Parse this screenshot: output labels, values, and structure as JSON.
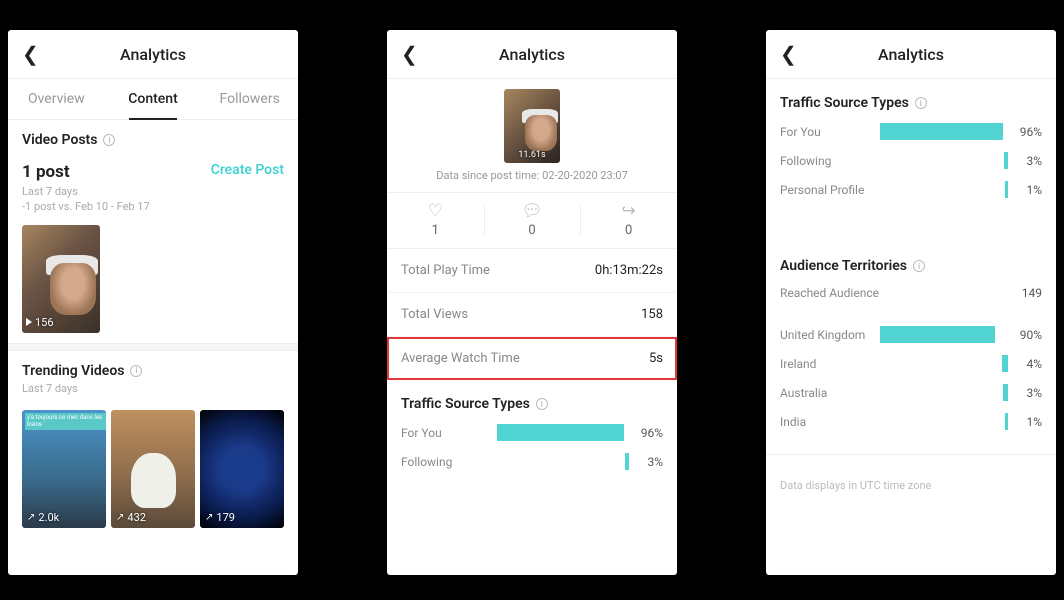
{
  "header": {
    "title": "Analytics"
  },
  "tabs": {
    "overview": "Overview",
    "content": "Content",
    "followers": "Followers"
  },
  "screen1": {
    "video_posts_title": "Video Posts",
    "post_count": "1 post",
    "create_post": "Create Post",
    "last7": "Last 7 days",
    "compare": "-1 post vs. Feb 10 - Feb 17",
    "thumb_plays": "156",
    "trending_title": "Trending Videos",
    "trending_sub": "Last 7 days",
    "trending": [
      {
        "label": "2.0k",
        "badge": "y'a toujours ce mec dans les trains"
      },
      {
        "label": "432"
      },
      {
        "label": "179"
      }
    ]
  },
  "screen2": {
    "duration": "11.61s",
    "since": "Data since post time: 02-20-2020 23:07",
    "likes": "1",
    "comments": "0",
    "shares": "0",
    "rows": [
      {
        "label": "Total Play Time",
        "val": "0h:13m:22s"
      },
      {
        "label": "Total Views",
        "val": "158"
      },
      {
        "label": "Average Watch Time",
        "val": "5s"
      }
    ],
    "traffic_title": "Traffic Source Types",
    "traffic": [
      {
        "label": "For You",
        "pct": 96,
        "disp": "96%"
      },
      {
        "label": "Following",
        "pct": 3,
        "disp": "3%"
      }
    ]
  },
  "screen3": {
    "traffic_title": "Traffic Source Types",
    "traffic": [
      {
        "label": "For You",
        "pct": 96,
        "disp": "96%"
      },
      {
        "label": "Following",
        "pct": 3,
        "disp": "3%"
      },
      {
        "label": "Personal Profile",
        "pct": 1,
        "disp": "1%"
      }
    ],
    "territories_title": "Audience Territories",
    "reached_label": "Reached Audience",
    "reached_val": "149",
    "countries": [
      {
        "label": "United Kingdom",
        "pct": 90,
        "disp": "90%"
      },
      {
        "label": "Ireland",
        "pct": 4,
        "disp": "4%"
      },
      {
        "label": "Australia",
        "pct": 3,
        "disp": "3%"
      },
      {
        "label": "India",
        "pct": 1,
        "disp": "1%"
      }
    ],
    "footnote": "Data displays in UTC time zone"
  },
  "chart_data": [
    {
      "type": "bar",
      "title": "Traffic Source Types",
      "categories": [
        "For You",
        "Following",
        "Personal Profile"
      ],
      "values": [
        96,
        3,
        1
      ],
      "xlabel": "",
      "ylabel": "percent",
      "ylim": [
        0,
        100
      ]
    },
    {
      "type": "bar",
      "title": "Audience Territories",
      "categories": [
        "United Kingdom",
        "Ireland",
        "Australia",
        "India"
      ],
      "values": [
        90,
        4,
        3,
        1
      ],
      "xlabel": "",
      "ylabel": "percent",
      "ylim": [
        0,
        100
      ]
    }
  ]
}
